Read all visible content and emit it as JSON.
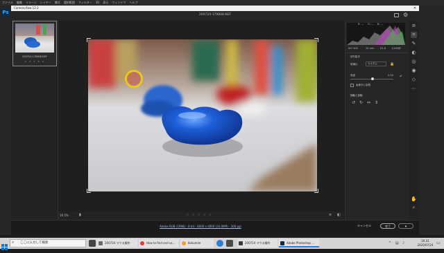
{
  "ps": {
    "menu": [
      "ファイル",
      "編集",
      "イメージ",
      "レイヤー",
      "書式",
      "選択範囲",
      "フィルター",
      "3D",
      "表示",
      "ウィンドウ",
      "ヘルプ"
    ],
    "logo": "Ps"
  },
  "dialog": {
    "title": "Camera Raw 12.3",
    "close": "✕",
    "filename": "200724-179808.NEF"
  },
  "filmstrip": {
    "thumb_name": "200724-179808.NEF",
    "thumb_stars": "★ ★ ★ ★ ★"
  },
  "panel": {
    "histo_readout": [
      "R: ---",
      "G: ---",
      "B: ---"
    ],
    "meta": [
      "ISO 400",
      "35 mm",
      "f/1.8",
      "1/160秒"
    ],
    "section1": "切り抜き",
    "aspect_label": "縦横比",
    "aspect_value": "カスタム",
    "angle_label": "角度",
    "angle_value": "0.00",
    "constrain_label": "画像内に制限",
    "section2": "回転と反転"
  },
  "bottom": {
    "zoom": "16.5%",
    "rating": "☆ ☆ ☆ ☆ ☆"
  },
  "status": {
    "info": "Adobe RGB (1998) - 8 bit - 6000 x 4000 (24.0MP) - 300 ppi",
    "cancel": "キャンセル",
    "done": "完了"
  },
  "taskbar": {
    "search_placeholder": "ここに入力して検索",
    "apps": [
      {
        "label": "200724 マウス操作",
        "color": "#6b6b6b"
      },
      {
        "label": "How to find and us...",
        "color": "#e23b2e"
      },
      {
        "label": "Kokumile",
        "color": "#f0a020"
      },
      {
        "label": "200724 マウス操作",
        "color": "#3a3a3a"
      },
      {
        "label": "Adobe Photoshop ...",
        "color": "#0c2b46"
      }
    ],
    "time": "20:31",
    "date": "2020/07/24"
  }
}
